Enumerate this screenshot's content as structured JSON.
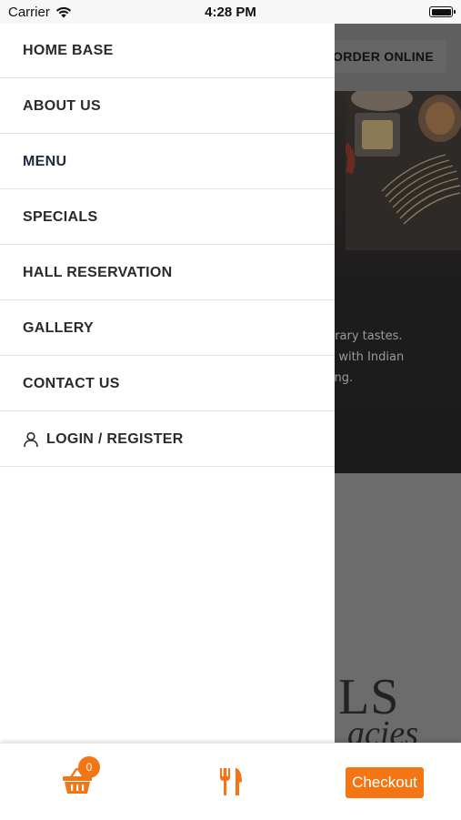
{
  "status_bar": {
    "carrier": "Carrier",
    "time": "4:28 PM"
  },
  "background_page": {
    "order_button": "ORDER ONLINE",
    "hero_lines": [
      "porary tastes.",
      "od with Indian",
      "ining."
    ],
    "heading_fragment": "LS",
    "italic_fragment": "acies"
  },
  "drawer": {
    "items": [
      {
        "label": "HOME BASE"
      },
      {
        "label": "ABOUT US"
      },
      {
        "label": "MENU"
      },
      {
        "label": "SPECIALS"
      },
      {
        "label": "HALL RESERVATION"
      },
      {
        "label": "GALLERY"
      },
      {
        "label": "CONTACT US"
      }
    ],
    "login_label": "LOGIN / REGISTER"
  },
  "bottom_bar": {
    "cart_count": "0",
    "checkout_label": "Checkout",
    "accent_color": "#f47514"
  }
}
